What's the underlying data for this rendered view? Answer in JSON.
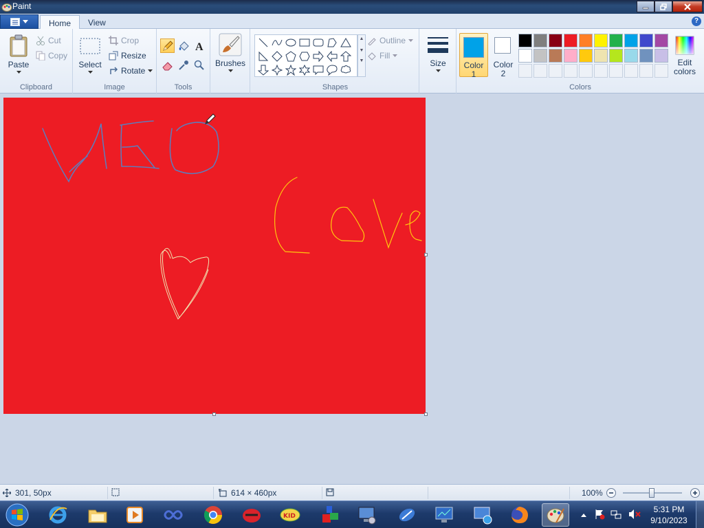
{
  "window": {
    "title": "Paint"
  },
  "tabs": [
    {
      "label": "Home",
      "active": true
    },
    {
      "label": "View",
      "active": false
    }
  ],
  "clipboard": {
    "paste": "Paste",
    "cut": "Cut",
    "copy": "Copy",
    "group": "Clipboard"
  },
  "image": {
    "select": "Select",
    "crop": "Crop",
    "resize": "Resize",
    "rotate": "Rotate",
    "group": "Image"
  },
  "tools": {
    "group": "Tools"
  },
  "brushes": {
    "label": "Brushes"
  },
  "shapes": {
    "outline": "Outline",
    "fill": "Fill",
    "group": "Shapes"
  },
  "size": {
    "label": "Size"
  },
  "colors": {
    "color1_label": "Color",
    "color1_num": "1",
    "color2_label": "Color",
    "color2_num": "2",
    "color1": "#00a2e8",
    "color2": "#ffffff",
    "edit_label": "Edit",
    "edit_label2": "colors",
    "group": "Colors",
    "palette_row1": [
      "#000000",
      "#7f7f7f",
      "#880015",
      "#ed1c24",
      "#ff7f27",
      "#fff200",
      "#22b14c",
      "#00a2e8",
      "#3f48cc",
      "#a349a4"
    ],
    "palette_row2": [
      "#ffffff",
      "#c3c3c3",
      "#b97a57",
      "#ffaec9",
      "#ffc90e",
      "#efe4b0",
      "#b5e61d",
      "#99d9ea",
      "#7092be",
      "#c8bfe7"
    ]
  },
  "canvas": {
    "background": "#ed1c24",
    "text_blue": "#5b7fbf",
    "text_yellow": "#ffc90e",
    "heart": "#efe4b0"
  },
  "status": {
    "cursor_pos": "301, 50px",
    "canvas_size": "614 × 460px",
    "zoom": "100%"
  },
  "taskbar": {
    "time": "5:31 PM",
    "date": "9/10/2023"
  }
}
